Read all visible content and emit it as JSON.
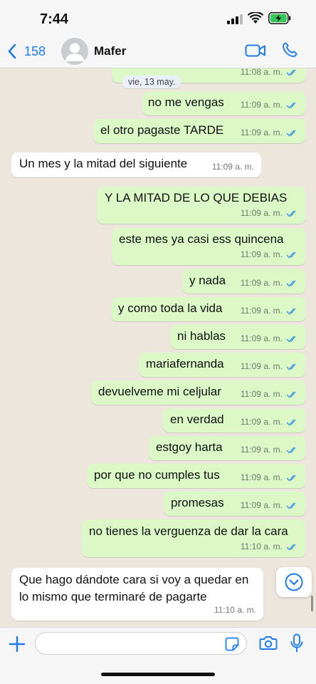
{
  "status_bar": {
    "time": "7:44"
  },
  "header": {
    "back_count": "158",
    "contact_name": "Mafer"
  },
  "date_separator": "vie, 13 may.",
  "messages": [
    {
      "text": "",
      "time": "11:08 a. m.",
      "read": true
    },
    {
      "text": "no me vengas",
      "time": "11:09 a. m.",
      "read": true
    },
    {
      "text": "el otro pagaste TARDE",
      "time": "11:09 a. m.",
      "read": true
    },
    {
      "text": "Un mes y la mitad del siguiente",
      "time": "11:09 a. m."
    },
    {
      "text": "Y LA MITAD DE LO QUE DEBIAS",
      "time": "11:09 a. m.",
      "read": true
    },
    {
      "text": "este mes ya casi ess quincena",
      "time": "11:09 a. m.",
      "read": true
    },
    {
      "text": "y nada",
      "time": "11:09 a. m.",
      "read": true
    },
    {
      "text": "y como toda la vida",
      "time": "11:09 a. m.",
      "read": true
    },
    {
      "text": "ni hablas",
      "time": "11:09 a. m.",
      "read": true
    },
    {
      "text": "mariafernanda",
      "time": "11:09 a. m.",
      "read": true
    },
    {
      "text": "devuelveme mi celjular",
      "time": "11:09 a. m.",
      "read": true
    },
    {
      "text": "en verdad",
      "time": "11:09 a. m.",
      "read": true
    },
    {
      "text": "estgoy harta",
      "time": "11:09 a. m.",
      "read": true
    },
    {
      "text": "por que no cumples tus",
      "time": "11:09 a. m.",
      "read": true
    },
    {
      "text": "promesas",
      "time": "11:09 a. m.",
      "read": true
    },
    {
      "text": "no tienes la verguenza de dar la cara",
      "time": "11:10 a. m.",
      "read": true
    },
    {
      "text_line1": "Que hago dándote cara si voy a quedar en",
      "text_line2": "lo mismo que terminaré de pagarte",
      "time": "11:10 a. m."
    }
  ],
  "composer": {
    "value": "",
    "placeholder": ""
  },
  "colors": {
    "outgoing_bubble": "#dcf8c6",
    "incoming_bubble": "#ffffff",
    "accent": "#1b7cf2",
    "read_ticks": "#4fa3e0"
  },
  "icons": [
    "back-chevron-icon",
    "video-call-icon",
    "phone-icon",
    "plus-icon",
    "sticker-icon",
    "camera-icon",
    "microphone-icon",
    "scroll-down-icon"
  ]
}
